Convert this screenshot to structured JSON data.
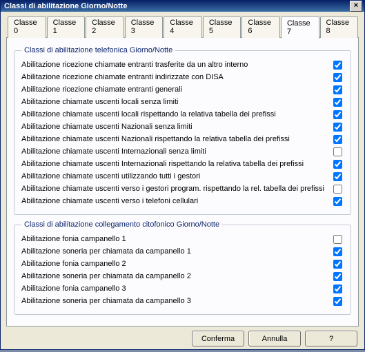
{
  "window": {
    "title": "Classi di abilitazione Giorno/Notte"
  },
  "tabs": [
    {
      "label": "Classe 0"
    },
    {
      "label": "Classe 1"
    },
    {
      "label": "Classe 2"
    },
    {
      "label": "Classe 3"
    },
    {
      "label": "Classe 4"
    },
    {
      "label": "Classe 5"
    },
    {
      "label": "Classe 6"
    },
    {
      "label": "Classe 7",
      "active": true
    },
    {
      "label": "Classe 8"
    }
  ],
  "group1": {
    "legend": "Classi di abilitazione telefonica Giorno/Notte",
    "items": [
      {
        "label": "Abilitazione ricezione chiamate entranti trasferite da un altro interno",
        "checked": true
      },
      {
        "label": "Abilitazione ricezione chiamate entranti indirizzate con DISA",
        "checked": true
      },
      {
        "label": "Abilitazione ricezione chiamate entranti generali",
        "checked": true
      },
      {
        "label": "Abilitazione chiamate uscenti locali senza limiti",
        "checked": true
      },
      {
        "label": "Abilitazione chiamate uscenti locali rispettando la relativa tabella dei prefissi",
        "checked": true
      },
      {
        "label": "Abilitazione chiamate uscenti Nazionali senza limiti",
        "checked": true
      },
      {
        "label": "Abilitazione chiamate uscenti Nazionali rispettando la relativa tabella dei prefissi",
        "checked": true
      },
      {
        "label": "Abilitazione chiamate uscenti Internazionali senza limiti",
        "checked": false
      },
      {
        "label": "Abilitazione chiamate uscenti Internazionali rispettando la relativa tabella dei prefissi",
        "checked": true
      },
      {
        "label": "Abilitazione chiamate uscenti utilizzando tutti i gestori",
        "checked": true
      },
      {
        "label": "Abilitazione chiamate uscenti verso i gestori program. rispettando la rel. tabella dei prefissi",
        "checked": false
      },
      {
        "label": "Abilitazione chiamate uscenti verso i telefoni cellulari",
        "checked": true
      }
    ]
  },
  "group2": {
    "legend": "Classi di abilitazione collegamento citofonico Giorno/Notte",
    "items": [
      {
        "label": "Abilitazione fonia campanello 1",
        "checked": false
      },
      {
        "label": "Abilitazione soneria per chiamata da campanello 1",
        "checked": true
      },
      {
        "label": "Abilitazione fonia campanello 2",
        "checked": true
      },
      {
        "label": "Abilitazione soneria per chiamata da campanello 2",
        "checked": true
      },
      {
        "label": "Abilitazione fonia campanello 3",
        "checked": true
      },
      {
        "label": "Abilitazione soneria per chiamata da campanello 3",
        "checked": true
      }
    ]
  },
  "buttons": {
    "confirm": "Conferma",
    "cancel": "Annulla",
    "help": "?"
  }
}
